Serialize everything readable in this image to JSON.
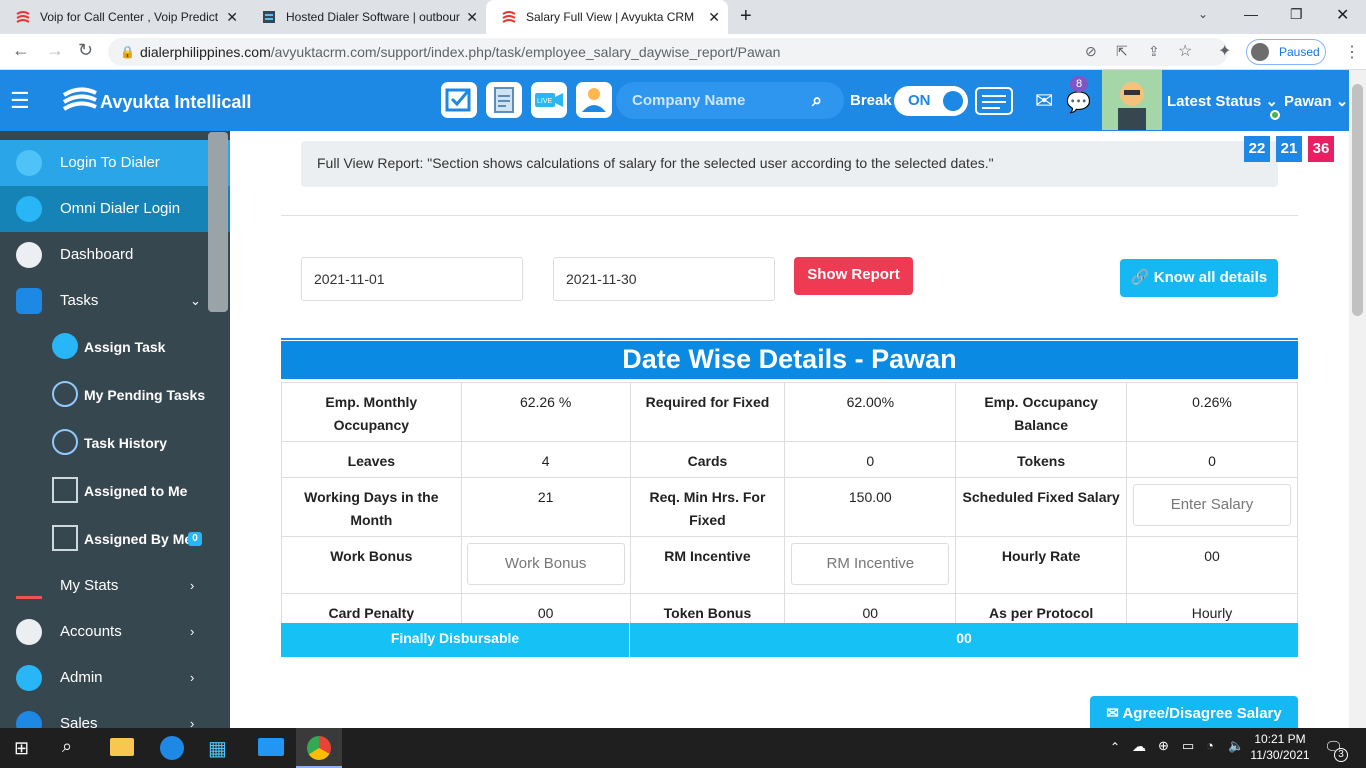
{
  "browser": {
    "tabs": [
      {
        "title": "Voip for Call Center , Voip Predict"
      },
      {
        "title": "Hosted Dialer Software | outbour"
      },
      {
        "title": "Salary Full View | Avyukta CRM"
      }
    ],
    "url_host": "dialerphilippines.com",
    "url_path": "/avyuktacrm.com/support/index.php/task/employee_salary_daywise_report/Pawan",
    "profile_status": "Paused"
  },
  "header": {
    "logo_text": "Avyukta Intellicall",
    "company_placeholder": "Company Name",
    "break_label": "Break",
    "toggle_label": "ON",
    "chat_count": "8",
    "latest_status": "Latest Status",
    "user_name": "Pawan"
  },
  "sidebar": {
    "items": [
      {
        "label": "Login To Dialer"
      },
      {
        "label": "Omni Dialer Login"
      },
      {
        "label": "Dashboard"
      },
      {
        "label": "Tasks"
      },
      {
        "label": "Assign Task"
      },
      {
        "label": "My Pending Tasks"
      },
      {
        "label": "Task History"
      },
      {
        "label": "Assigned to Me"
      },
      {
        "label": "Assigned By Me",
        "badge": "0"
      },
      {
        "label": "My Stats"
      },
      {
        "label": "Accounts"
      },
      {
        "label": "Admin"
      },
      {
        "label": "Sales"
      }
    ]
  },
  "info_text": "Full View Report: \"Section shows calculations of salary for the selected user according to the selected dates.\"",
  "counters": [
    "22",
    "21",
    "36"
  ],
  "filters": {
    "from_date": "2021-11-01",
    "to_date": "2021-11-30",
    "show_report": "Show Report",
    "know_all": "Know all details"
  },
  "report": {
    "title": "Date Wise Details - Pawan",
    "rows": [
      [
        "Emp. Monthly Occupancy",
        "62.26 %",
        "Required for Fixed",
        "62.00%",
        "Emp. Occupancy Balance",
        "0.26%"
      ],
      [
        "Leaves",
        "4",
        "Cards",
        "0",
        "Tokens",
        "0"
      ],
      [
        "Working Days in the Month",
        "21",
        "Req. Min Hrs. For Fixed",
        "150.00",
        "Scheduled Fixed Salary",
        "Enter Salary"
      ],
      [
        "Work Bonus",
        "Work Bonus",
        "RM Incentive",
        "RM Incentive",
        "Hourly Rate",
        "00"
      ],
      [
        "Card Penalty",
        "00",
        "Token Bonus",
        "00",
        "As per Protocol",
        "Hourly"
      ]
    ],
    "final_label": "Finally Disbursable",
    "final_value": "00",
    "agree_label": "Agree/Disagree Salary"
  },
  "taskbar": {
    "time": "10:21 PM",
    "date": "11/30/2021",
    "notifications": "3"
  }
}
